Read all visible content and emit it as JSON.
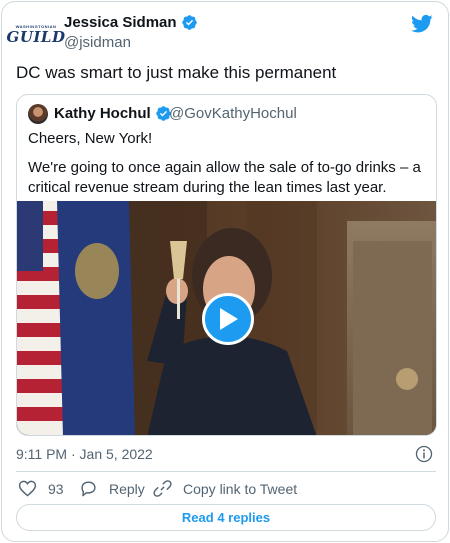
{
  "tweet": {
    "author": {
      "name": "Jessica Sidman",
      "handle": "@jsidman",
      "avatar_small_text": "WASHINGTONIAN",
      "avatar_big_text": "GUILD"
    },
    "text": "DC was smart to just make this permanent",
    "timestamp": "9:11 PM · Jan 5, 2022"
  },
  "quoted": {
    "name": "Kathy Hochul",
    "handle": "@GovKathyHochul",
    "line1": "Cheers, New York!",
    "body": "We're going to once again allow the sale of to-go drinks – a critical revenue stream during the lean times last year."
  },
  "actions": {
    "like_count": "93",
    "reply_label": "Reply",
    "copy_label": "Copy link to Tweet",
    "read_replies": "Read 4 replies"
  },
  "colors": {
    "twitter_blue": "#1d9bf0",
    "text_primary": "#0f1419",
    "text_secondary": "#536471",
    "border": "#cfd9de"
  },
  "icons": [
    "verified-icon",
    "twitter-logo-icon",
    "play-icon",
    "info-icon",
    "heart-icon",
    "reply-icon",
    "link-icon"
  ]
}
